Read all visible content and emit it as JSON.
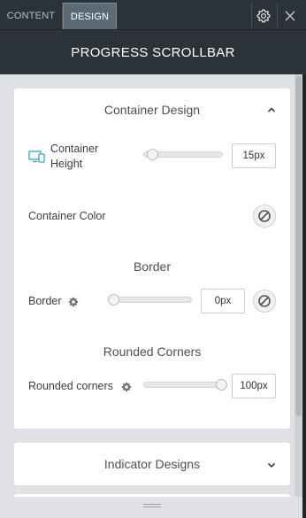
{
  "tabs": {
    "content": "CONTENT",
    "design": "DESIGN"
  },
  "header": {
    "title": "PROGRESS SCROLLBAR",
    "settings_icon": "gear-icon",
    "close_icon": "close-icon"
  },
  "container_design": {
    "title": "Container Design",
    "height_label": "Container Height",
    "height_device_icon": "desktop-tablet-icon",
    "height_value": "15px",
    "height_slider_fraction": 0.05,
    "color_label": "Container Color",
    "border_heading": "Border",
    "border_label": "Border",
    "border_value": "0px",
    "border_slider_fraction": 0,
    "rounded_heading": "Rounded Corners",
    "rounded_label": "Rounded corners",
    "rounded_value": "100px",
    "rounded_slider_fraction": 1
  },
  "indicator_designs": {
    "title": "Indicator Designs"
  },
  "colors": {
    "header_bg": "#2b3338",
    "active_tab_bg": "#5b6a75",
    "device_icon": "#3aa6c4"
  }
}
